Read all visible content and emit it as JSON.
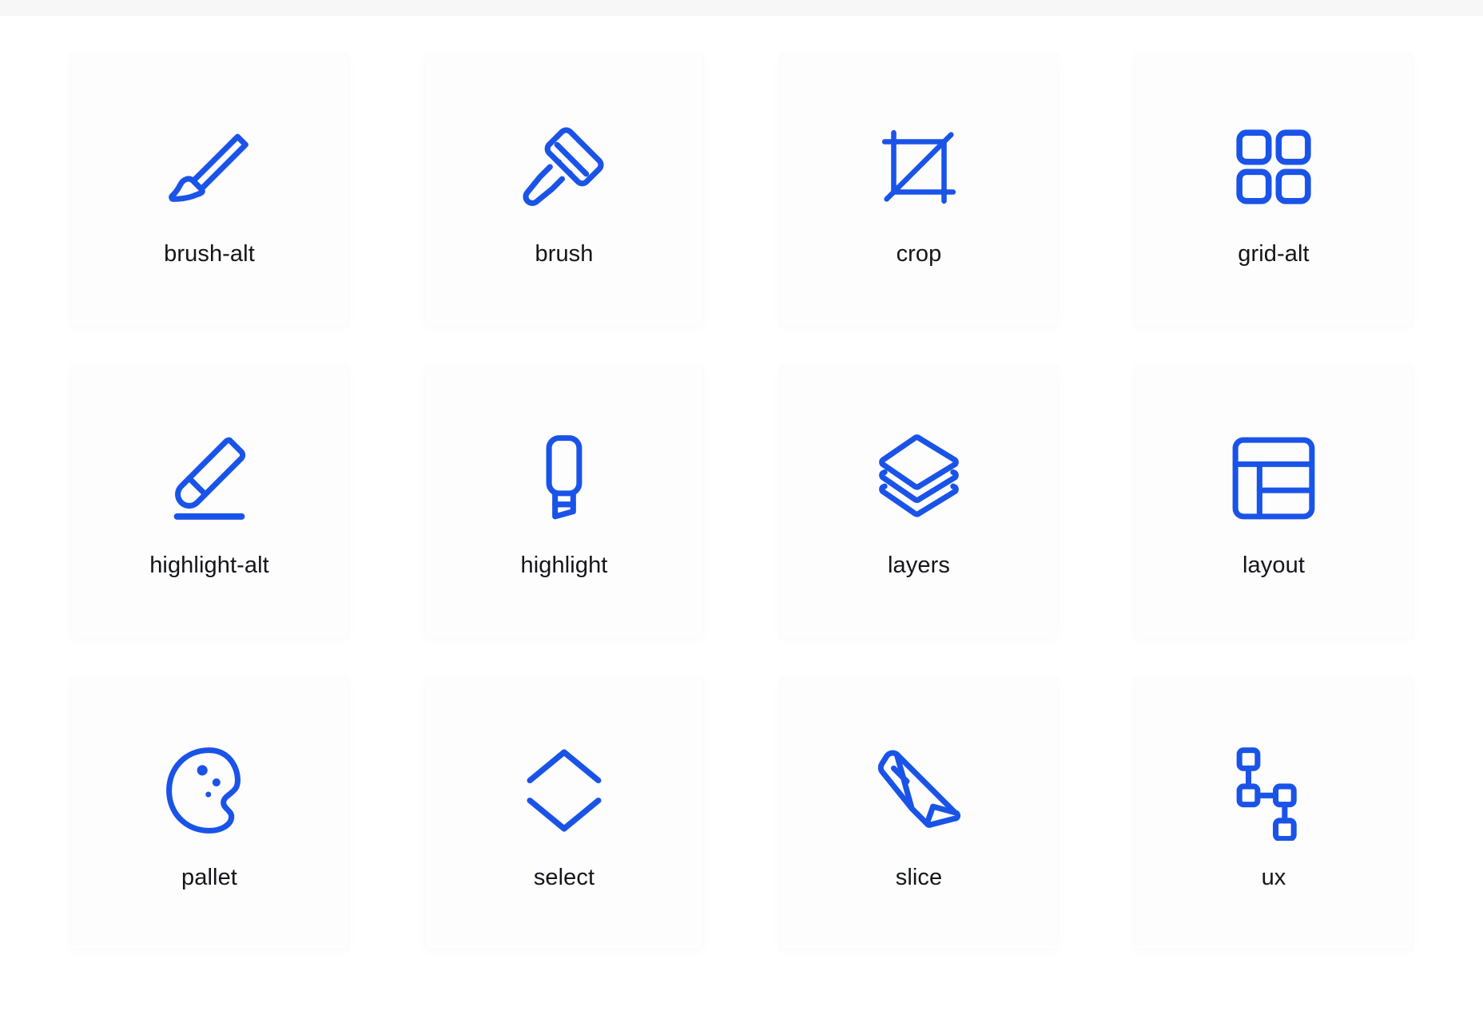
{
  "page": {
    "background_color": "#ffffff",
    "card_background_color": "#fdfdfe",
    "accent_color": "#1a53e8",
    "label_color": "#14151a",
    "top_strip_color": "#f7f7f8"
  },
  "grid": {
    "columns": 4,
    "rows": 3,
    "items": [
      {
        "label": "brush-alt",
        "icon": "brush-alt-icon"
      },
      {
        "label": "brush",
        "icon": "brush-icon"
      },
      {
        "label": "crop",
        "icon": "crop-icon"
      },
      {
        "label": "grid-alt",
        "icon": "grid-alt-icon"
      },
      {
        "label": "highlight-alt",
        "icon": "highlight-alt-icon"
      },
      {
        "label": "highlight",
        "icon": "highlight-icon"
      },
      {
        "label": "layers",
        "icon": "layers-icon"
      },
      {
        "label": "layout",
        "icon": "layout-icon"
      },
      {
        "label": "pallet",
        "icon": "pallet-icon"
      },
      {
        "label": "select",
        "icon": "select-icon"
      },
      {
        "label": "slice",
        "icon": "slice-icon"
      },
      {
        "label": "ux",
        "icon": "ux-icon"
      }
    ]
  }
}
